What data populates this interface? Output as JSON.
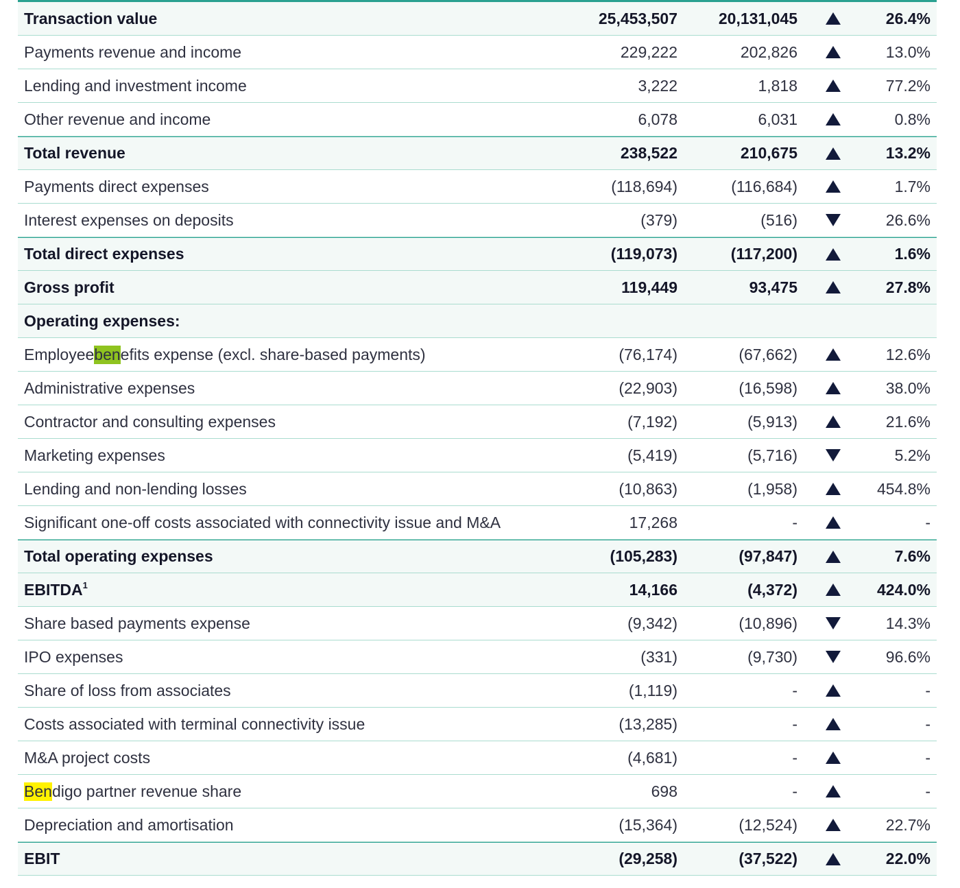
{
  "rows": [
    {
      "label": "Transaction value",
      "v1": "25,453,507",
      "v2": "20,131,045",
      "dir": "up",
      "pct": "26.4%",
      "bold": true
    },
    {
      "label": "Payments revenue and income",
      "v1": "229,222",
      "v2": "202,826",
      "dir": "up",
      "pct": "13.0%"
    },
    {
      "label": "Lending and investment income",
      "v1": "3,222",
      "v2": "1,818",
      "dir": "up",
      "pct": "77.2%"
    },
    {
      "label": "Other revenue and income",
      "v1": "6,078",
      "v2": "6,031",
      "dir": "up",
      "pct": "0.8%"
    },
    {
      "label": "Total revenue",
      "v1": "238,522",
      "v2": "210,675",
      "dir": "up",
      "pct": "13.2%",
      "bold": true
    },
    {
      "label": "Payments direct expenses",
      "v1": "(118,694)",
      "v2": "(116,684)",
      "dir": "up",
      "pct": "1.7%"
    },
    {
      "label": "Interest expenses on deposits",
      "v1": "(379)",
      "v2": "(516)",
      "dir": "down",
      "pct": "26.6%"
    },
    {
      "label": "Total direct expenses",
      "v1": "(119,073)",
      "v2": "(117,200)",
      "dir": "up",
      "pct": "1.6%",
      "bold": true
    },
    {
      "label": "Gross profit",
      "v1": "119,449",
      "v2": "93,475",
      "dir": "up",
      "pct": "27.8%",
      "bold": true
    },
    {
      "label": "Operating expenses:",
      "v1": "",
      "v2": "",
      "dir": "",
      "pct": "",
      "section": true
    },
    {
      "label_pre": "Employee ",
      "label_hl": "ben",
      "label_post": "efits expense (excl. share-based payments)",
      "hl": "green",
      "v1": "(76,174)",
      "v2": "(67,662)",
      "dir": "up",
      "pct": "12.6%"
    },
    {
      "label": "Administrative expenses",
      "v1": "(22,903)",
      "v2": "(16,598)",
      "dir": "up",
      "pct": "38.0%"
    },
    {
      "label": "Contractor and consulting expenses",
      "v1": "(7,192)",
      "v2": "(5,913)",
      "dir": "up",
      "pct": "21.6%"
    },
    {
      "label": "Marketing expenses",
      "v1": "(5,419)",
      "v2": "(5,716)",
      "dir": "down",
      "pct": "5.2%"
    },
    {
      "label": "Lending and non-lending losses",
      "v1": "(10,863)",
      "v2": "(1,958)",
      "dir": "up",
      "pct": "454.8%"
    },
    {
      "label": "Significant one-off costs associated with connectivity issue and M&A",
      "v1": "17,268",
      "v2": "-",
      "dir": "up",
      "pct": "-"
    },
    {
      "label": "Total operating expenses",
      "v1": "(105,283)",
      "v2": "(97,847)",
      "dir": "up",
      "pct": "7.6%",
      "bold": true
    },
    {
      "label": "EBITDA",
      "sup": "1",
      "v1": "14,166",
      "v2": "(4,372)",
      "dir": "up",
      "pct": "424.0%",
      "bold": true
    },
    {
      "label": "Share based payments expense",
      "v1": "(9,342)",
      "v2": "(10,896)",
      "dir": "down",
      "pct": "14.3%"
    },
    {
      "label": "IPO expenses",
      "v1": "(331)",
      "v2": "(9,730)",
      "dir": "down",
      "pct": "96.6%"
    },
    {
      "label": "Share of loss from associates",
      "v1": "(1,119)",
      "v2": "-",
      "dir": "up",
      "pct": "-"
    },
    {
      "label": "Costs associated with terminal connectivity issue",
      "v1": "(13,285)",
      "v2": "-",
      "dir": "up",
      "pct": "-"
    },
    {
      "label": "M&A project costs",
      "v1": "(4,681)",
      "v2": "-",
      "dir": "up",
      "pct": "-"
    },
    {
      "label_pre": "",
      "label_hl": "Ben",
      "label_post": "digo partner revenue share",
      "hl": "yellow",
      "v1": "698",
      "v2": "-",
      "dir": "up",
      "pct": "-"
    },
    {
      "label": "Depreciation and amortisation",
      "v1": "(15,364)",
      "v2": "(12,524)",
      "dir": "up",
      "pct": "22.7%"
    },
    {
      "label": "EBIT",
      "v1": "(29,258)",
      "v2": "(37,522)",
      "dir": "up",
      "pct": "22.0%",
      "bold": true
    }
  ]
}
